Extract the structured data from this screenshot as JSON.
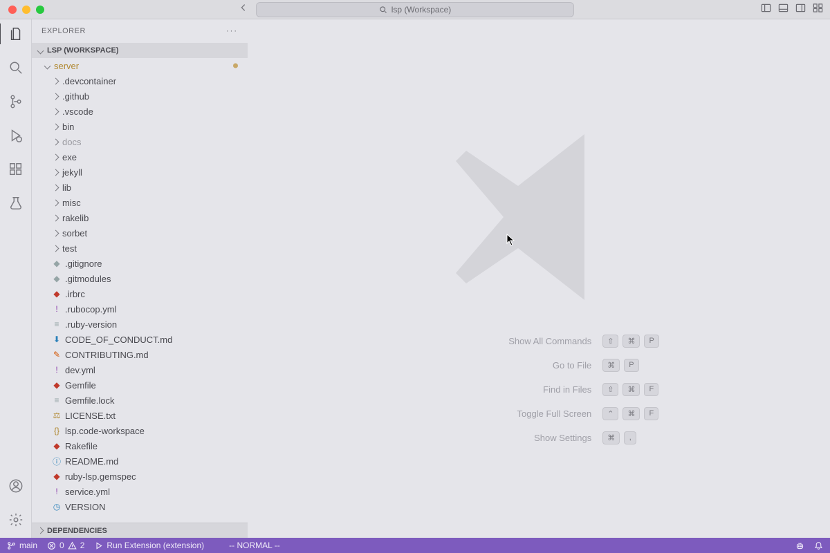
{
  "titlebar": {
    "search": "lsp (Workspace)"
  },
  "sidebar": {
    "title": "EXPLORER",
    "workspace": "LSP (WORKSPACE)",
    "dependencies": "DEPENDENCIES",
    "server": "server",
    "folders": {
      "devcontainer": ".devcontainer",
      "github": ".github",
      "vscode": ".vscode",
      "bin": "bin",
      "docs": "docs",
      "exe": "exe",
      "jekyll": "jekyll",
      "lib": "lib",
      "misc": "misc",
      "rakelib": "rakelib",
      "sorbet": "sorbet",
      "test": "test"
    },
    "files": {
      "gitignore": ".gitignore",
      "gitmodules": ".gitmodules",
      "irbrc": ".irbrc",
      "rubocop": ".rubocop.yml",
      "rubyversion": ".ruby-version",
      "coc": "CODE_OF_CONDUCT.md",
      "contributing": "CONTRIBUTING.md",
      "devyml": "dev.yml",
      "gemfile": "Gemfile",
      "gemfilelock": "Gemfile.lock",
      "license": "LICENSE.txt",
      "workspace": "lsp.code-workspace",
      "rakefile": "Rakefile",
      "readme": "README.md",
      "gemspec": "ruby-lsp.gemspec",
      "service": "service.yml",
      "version": "VERSION"
    }
  },
  "welcome": {
    "s1": {
      "label": "Show All Commands",
      "k1": "⇧",
      "k2": "⌘",
      "k3": "P"
    },
    "s2": {
      "label": "Go to File",
      "k1": "⌘",
      "k2": "P"
    },
    "s3": {
      "label": "Find in Files",
      "k1": "⇧",
      "k2": "⌘",
      "k3": "F"
    },
    "s4": {
      "label": "Toggle Full Screen",
      "k1": "⌃",
      "k2": "⌘",
      "k3": "F"
    },
    "s5": {
      "label": "Show Settings",
      "k1": "⌘",
      "k2": ","
    }
  },
  "status": {
    "branch": "main",
    "errors": "0",
    "warnings": "2",
    "run": "Run Extension (extension)",
    "mode": "-- NORMAL --"
  }
}
